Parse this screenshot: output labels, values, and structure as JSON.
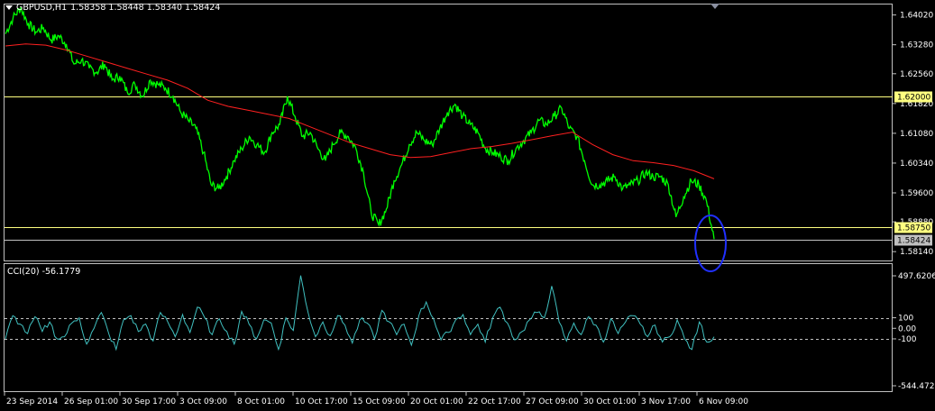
{
  "header": {
    "symbol_title": "GBPUSD,H1",
    "ohlc": "1.58358 1.58448 1.58340 1.58424"
  },
  "indicator": {
    "title": "CCI(20) -56.1779"
  },
  "price_axis": {
    "ticks": [
      "1.64020",
      "1.63280",
      "1.62560",
      "1.61820",
      "1.61080",
      "1.60340",
      "1.59600",
      "1.58880",
      "1.58140"
    ],
    "levels": [
      {
        "label": "1.62000",
        "value": 1.62,
        "color": "#ffff80"
      },
      {
        "label": "1.58750",
        "value": 1.5875,
        "color": "#ffff80"
      },
      {
        "label": "1.58424",
        "value": 1.58424,
        "color": "#c0c0c0"
      }
    ]
  },
  "cci_axis": {
    "ticks": [
      "497.6206",
      "100",
      "0.00",
      "-100",
      "-544.4729"
    ]
  },
  "time_axis": {
    "labels": [
      "23 Sep 2014",
      "26 Sep 01:00",
      "30 Sep 17:00",
      "3 Oct 09:00",
      "8 Oct 01:00",
      "10 Oct 17:00",
      "15 Oct 09:00",
      "20 Oct 01:00",
      "22 Oct 17:00",
      "27 Oct 09:00",
      "30 Oct 01:00",
      "3 Nov 17:00",
      "6 Nov 09:00"
    ]
  },
  "colors": {
    "background": "#000000",
    "price_line": "#00ff00",
    "moving_average": "#ff2020",
    "cci_line": "#40c0c0",
    "level_line": "#ffff80",
    "grid_frame": "#c0c0c0",
    "highlight_ellipse": "#2030ff"
  },
  "chart_data": [
    {
      "type": "line",
      "title": "GBPUSD,H1",
      "ylim": [
        1.5792,
        1.6428
      ],
      "series": [
        {
          "name": "GBPUSD",
          "values": [
            1.6355,
            1.6395,
            1.642,
            1.638,
            1.636,
            1.637,
            1.634,
            1.635,
            1.633,
            1.628,
            1.629,
            1.627,
            1.626,
            1.628,
            1.624,
            1.625,
            1.621,
            1.623,
            1.62,
            1.624,
            1.623,
            1.622,
            1.62,
            1.616,
            1.614,
            1.612,
            1.606,
            1.598,
            1.597,
            1.6,
            1.604,
            1.607,
            1.61,
            1.608,
            1.606,
            1.611,
            1.613,
            1.62,
            1.615,
            1.61,
            1.611,
            1.607,
            1.604,
            1.608,
            1.611,
            1.61,
            1.607,
            1.601,
            1.591,
            1.588,
            1.592,
            1.599,
            1.603,
            1.608,
            1.611,
            1.609,
            1.608,
            1.612,
            1.616,
            1.618,
            1.615,
            1.613,
            1.611,
            1.607,
            1.606,
            1.605,
            1.604,
            1.607,
            1.609,
            1.611,
            1.614,
            1.613,
            1.615,
            1.617,
            1.612,
            1.61,
            1.604,
            1.598,
            1.598,
            1.599,
            1.6,
            1.597,
            1.598,
            1.599,
            1.601,
            1.6,
            1.6,
            1.598,
            1.59,
            1.595,
            1.599,
            1.598,
            1.594,
            1.5845
          ]
        },
        {
          "name": "MA",
          "values": [
            1.6325,
            1.633,
            1.6327,
            1.6315,
            1.63,
            1.6285,
            1.627,
            1.6255,
            1.624,
            1.622,
            1.619,
            1.6175,
            1.6165,
            1.6155,
            1.6145,
            1.6125,
            1.6105,
            1.6085,
            1.607,
            1.6055,
            1.6048,
            1.605,
            1.606,
            1.607,
            1.6075,
            1.6083,
            1.6092,
            1.6102,
            1.6111,
            1.608,
            1.6055,
            1.604,
            1.6035,
            1.6028,
            1.6015,
            1.5995
          ]
        }
      ]
    },
    {
      "type": "line",
      "title": "CCI(20) -56.1779",
      "ylim": [
        -544.4729,
        497.6206
      ],
      "series": [
        {
          "name": "CCI(20)",
          "values": [
            -100,
            120,
            40,
            -50,
            110,
            -30,
            60,
            -100,
            -80,
            50,
            100,
            -150,
            0,
            150,
            -50,
            -200,
            80,
            120,
            -30,
            40,
            -120,
            150,
            60,
            -80,
            130,
            -40,
            200,
            100,
            -60,
            90,
            -30,
            -150,
            160,
            40,
            -100,
            80,
            50,
            -200,
            100,
            -20,
            500,
            150,
            -80,
            60,
            -70,
            120,
            30,
            -140,
            80,
            50,
            -100,
            170,
            60,
            -60,
            40,
            -160,
            120,
            250,
            90,
            -110,
            -40,
            80,
            130,
            -60,
            40,
            -130,
            100,
            200,
            50,
            -110,
            -30,
            80,
            150,
            100,
            400,
            60,
            -120,
            50,
            -60,
            110,
            30,
            -130,
            90,
            -50,
            60,
            120,
            40,
            -80,
            30,
            -130,
            -80,
            80,
            -100,
            -200,
            60,
            -130,
            -80
          ]
        }
      ]
    }
  ]
}
